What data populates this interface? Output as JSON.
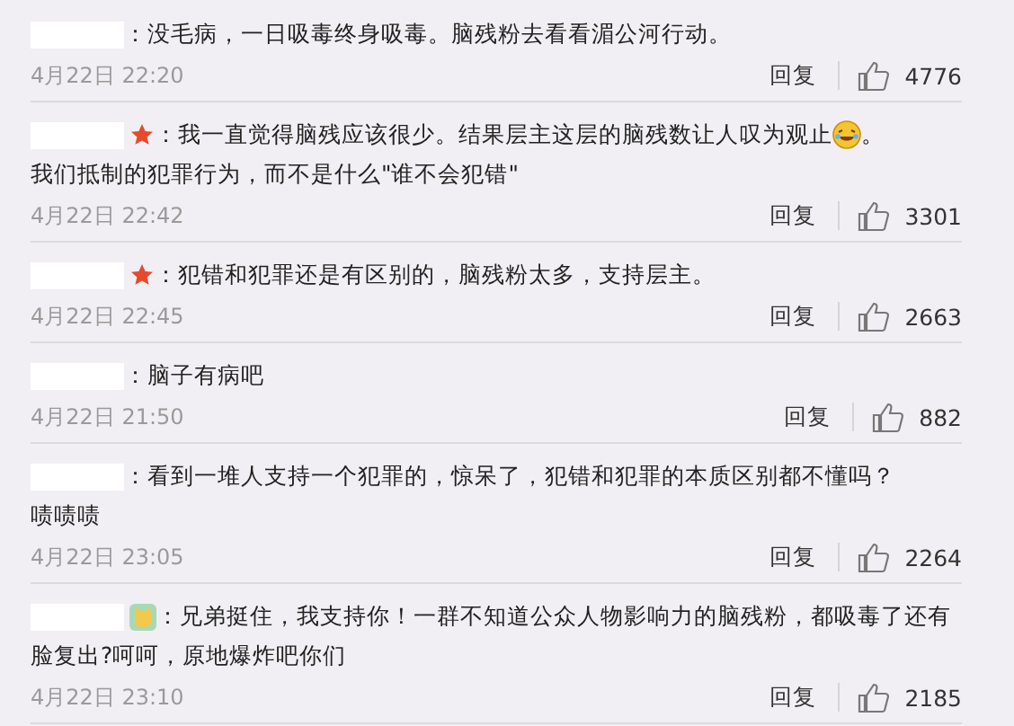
{
  "comments": [
    {
      "kind": "plain",
      "lines": [
        [
          {
            "kind": "text",
            "text": "：没毛病，一日吸毒终身吸毒。脑残粉去看看湄公河行动。"
          }
        ]
      ],
      "time": "4月22日 22:20",
      "reply": "回复",
      "likes": "4776"
    },
    {
      "kind": "star",
      "lines": [
        [
          {
            "kind": "text",
            "text": "：我一直觉得脑残应该很少。结果层主这层的脑残数让人叹为观止"
          },
          {
            "kind": "emoji"
          },
          {
            "kind": "text",
            "text": "。"
          }
        ],
        [
          {
            "kind": "text",
            "text": "我们抵制的犯罪行为，而不是什么\"谁不会犯错\""
          }
        ]
      ],
      "time": "4月22日 22:42",
      "reply": "回复",
      "likes": "3301"
    },
    {
      "kind": "star",
      "lines": [
        [
          {
            "kind": "text",
            "text": "：犯错和犯罪还是有区别的，脑残粉太多，支持层主。"
          }
        ]
      ],
      "time": "4月22日 22:45",
      "reply": "回复",
      "likes": "2663"
    },
    {
      "kind": "plain",
      "lines": [
        [
          {
            "kind": "text",
            "text": "：脑子有病吧"
          }
        ]
      ],
      "time": "4月22日 21:50",
      "reply": "回复",
      "likes": "882"
    },
    {
      "kind": "plain",
      "lines": [
        [
          {
            "kind": "text",
            "text": "：看到一堆人支持一个犯罪的，惊呆了，犯错和犯罪的本质区别都不懂吗？"
          }
        ],
        [
          {
            "kind": "text",
            "text": "啧啧啧"
          }
        ]
      ],
      "time": "4月22日 23:05",
      "reply": "回复",
      "likes": "2264"
    },
    {
      "kind": "cat",
      "lines": [
        [
          {
            "kind": "text",
            "text": "：兄弟挺住，我支持你！一群不知道公众人物影响力的脑残粉，都吸毒了还有"
          }
        ],
        [
          {
            "kind": "text",
            "text": "脸复出?呵呵，原地爆炸吧你们"
          }
        ]
      ],
      "time": "4月22日 23:10",
      "reply": "回复",
      "likes": "2185"
    }
  ]
}
